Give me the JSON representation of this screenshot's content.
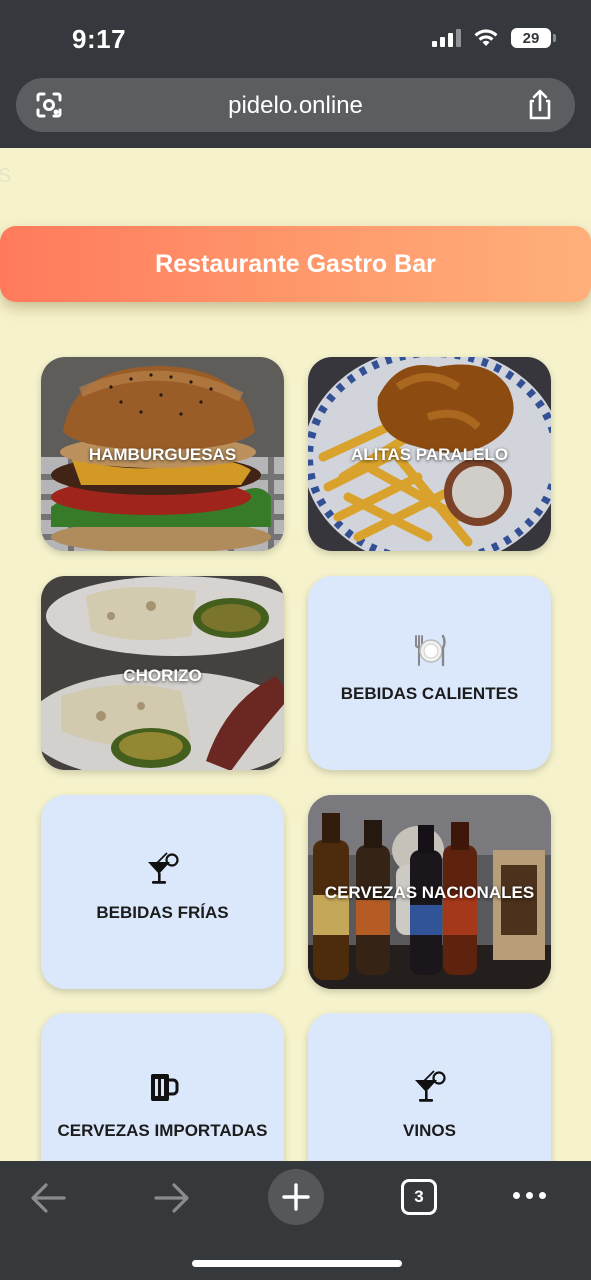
{
  "status_bar": {
    "time": "9:17",
    "battery": "29"
  },
  "browser": {
    "url": "pidelo.online",
    "tab_count": "3"
  },
  "page": {
    "stray_text": "S",
    "banner_title": "Restaurante Gastro Bar",
    "categories": [
      {
        "label": "HAMBURGUESAS",
        "icon": "photo-burger"
      },
      {
        "label": "ALITAS PARALELO",
        "icon": "photo-wings"
      },
      {
        "label": "CHORIZO",
        "icon": "photo-chorizo"
      },
      {
        "label": "BEBIDAS CALIENTES",
        "icon": "plate-cutlery-icon"
      },
      {
        "label": "BEBIDAS FRÍAS",
        "icon": "cocktail-icon"
      },
      {
        "label": "CERVEZAS NACIONALES",
        "icon": "photo-beers"
      },
      {
        "label": "CERVEZAS IMPORTADAS",
        "icon": "beer-mug-icon"
      },
      {
        "label": "VINOS",
        "icon": "cocktail-icon"
      }
    ]
  },
  "colors": {
    "page_bg": "#f6f3cc",
    "banner_gradient_start": "#ff7a5c",
    "banner_gradient_end": "#ffb07a",
    "card_bg": "#dbe8fb",
    "chrome_bg": "#35383c"
  }
}
